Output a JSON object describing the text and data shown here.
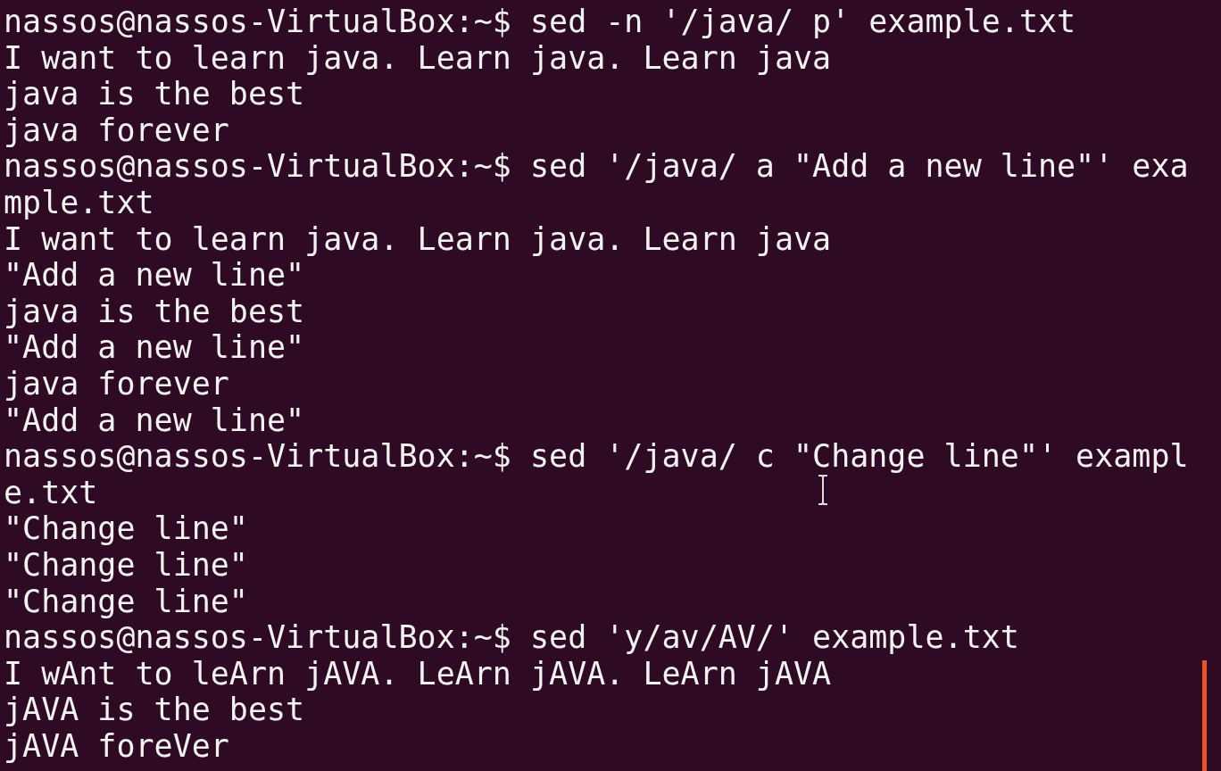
{
  "terminal": {
    "lines": [
      "nassos@nassos-VirtualBox:~$ sed -n '/java/ p' example.txt",
      "I want to learn java. Learn java. Learn java",
      "java is the best",
      "java forever",
      "nassos@nassos-VirtualBox:~$ sed '/java/ a \"Add a new line\"' exa",
      "mple.txt",
      "I want to learn java. Learn java. Learn java",
      "\"Add a new line\"",
      "java is the best",
      "\"Add a new line\"",
      "java forever",
      "\"Add a new line\"",
      "nassos@nassos-VirtualBox:~$ sed '/java/ c \"Change line\"' exampl",
      "e.txt",
      "\"Change line\"",
      "\"Change line\"",
      "\"Change line\"",
      "nassos@nassos-VirtualBox:~$ sed 'y/av/AV/' example.txt",
      "I wAnt to leArn jAVA. LeArn jAVA. LeArn jAVA",
      "jAVA is the best",
      "jAVA foreVer"
    ]
  }
}
